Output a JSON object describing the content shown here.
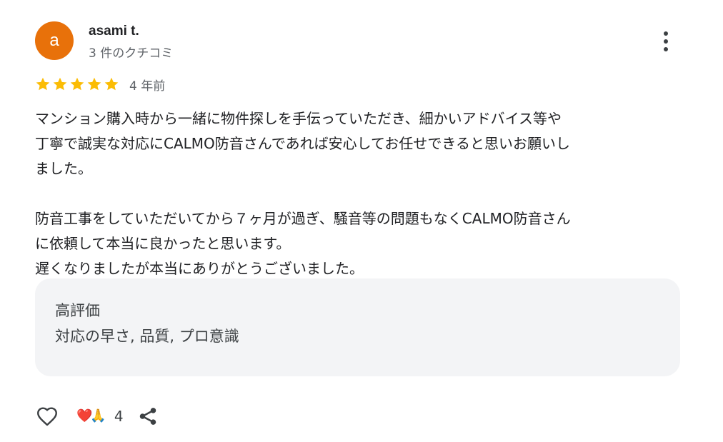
{
  "author": {
    "avatar_letter": "a",
    "avatar_color": "#e8710a",
    "name": "asami t.",
    "review_count": "3 件のクチコミ"
  },
  "menu": {
    "icon": "more-vert-icon"
  },
  "rating": {
    "stars": 5,
    "max_stars": 5,
    "star_color": "#fbbc04",
    "date": "4 年前"
  },
  "review": {
    "paragraph_1": "マンション購入時から一緒に物件探しを手伝っていただき、細かいアドバイス等や\n丁寧で誠実な対応にCALMO防音さんであれば安心してお任せできると思いお願いし\nました。",
    "paragraph_2": "防音工事をしていただいてから７ヶ月が過ぎ、騒音等の問題もなくCALMO防音さん\nに依頼して本当に良かったと思います。\n遅くなりましたが本当にありがとうございました。"
  },
  "highlights": {
    "title": "高評価",
    "items": "対応の早さ, 品質, プロ意識"
  },
  "actions": {
    "like_icon": "heart-outline-icon",
    "reactions": "❤️🙏",
    "reaction_count": "4",
    "share_icon": "share-icon"
  }
}
